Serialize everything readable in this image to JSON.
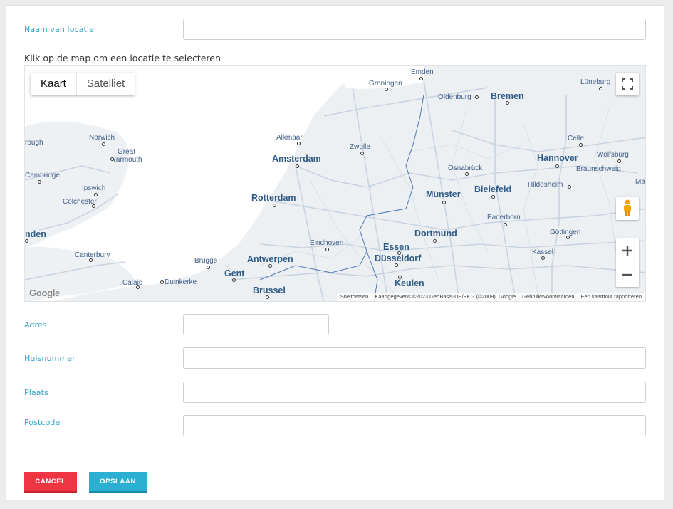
{
  "form": {
    "name_label": "Naam van locatie",
    "name_value": "",
    "map_hint": "Klik op de map om een locatie te selecteren",
    "address_label": "Adres",
    "address_value": "",
    "housenumber_label": "Huisnummer",
    "housenumber_value": "",
    "city_label": "Plaats",
    "city_value": "",
    "postcode_label": "Postcode",
    "postcode_value": ""
  },
  "map": {
    "type_options": [
      "Kaart",
      "Satelliet"
    ],
    "selected_type": "Kaart",
    "fullscreen_icon": "fullscreen-icon",
    "streetview_icon": "pegman-icon",
    "zoom_in": "+",
    "zoom_out": "−",
    "google_logo": "Google",
    "attribution": {
      "shortcuts": "Sneltoetsen",
      "mapdata": "Kaartgegevens ©2023 GeoBasis-DE/BKG (©2009), Google",
      "terms": "Gebruiksvoorwaarden",
      "report": "Een kaartfout rapporteren"
    },
    "cities": [
      {
        "name": "Emden",
        "size": "sm"
      },
      {
        "name": "Groningen",
        "size": "sm"
      },
      {
        "name": "Oldenburg",
        "size": "sm"
      },
      {
        "name": "Bremen",
        "size": "big"
      },
      {
        "name": "Lüneburg",
        "size": "sm"
      },
      {
        "name": "Norwich",
        "size": "sm"
      },
      {
        "name": "Great",
        "size": "sm"
      },
      {
        "name": "Yarmouth",
        "size": "sm"
      },
      {
        "name": "rough",
        "size": "sm"
      },
      {
        "name": "Alkmaar",
        "size": "sm"
      },
      {
        "name": "Amsterdam",
        "size": "big"
      },
      {
        "name": "Zwolle",
        "size": "sm"
      },
      {
        "name": "Celle",
        "size": "sm"
      },
      {
        "name": "Hannover",
        "size": "big"
      },
      {
        "name": "Wolfsburg",
        "size": "sm"
      },
      {
        "name": "Braunschweig",
        "size": "sm"
      },
      {
        "name": "Osnabrück",
        "size": "sm"
      },
      {
        "name": "Cambridge",
        "size": "sm"
      },
      {
        "name": "Ipswich",
        "size": "sm"
      },
      {
        "name": "Colchester",
        "size": "sm"
      },
      {
        "name": "Rotterdam",
        "size": "big"
      },
      {
        "name": "Münster",
        "size": "big"
      },
      {
        "name": "Bielefeld",
        "size": "big"
      },
      {
        "name": "Hildesheim",
        "size": "sm"
      },
      {
        "name": "Ma",
        "size": "sm"
      },
      {
        "name": "Paderborn",
        "size": "sm"
      },
      {
        "name": "nden",
        "size": "big"
      },
      {
        "name": "Dortmund",
        "size": "big"
      },
      {
        "name": "Göttingen",
        "size": "sm"
      },
      {
        "name": "Eindhoven",
        "size": "sm"
      },
      {
        "name": "Essen",
        "size": "big"
      },
      {
        "name": "Canterbury",
        "size": "sm"
      },
      {
        "name": "Düsseldorf",
        "size": "big"
      },
      {
        "name": "Kassel",
        "size": "sm"
      },
      {
        "name": "Brugge",
        "size": "sm"
      },
      {
        "name": "Antwerpen",
        "size": "big"
      },
      {
        "name": "Gent",
        "size": "big"
      },
      {
        "name": "Calais",
        "size": "sm"
      },
      {
        "name": "Duinkerke",
        "size": "sm"
      },
      {
        "name": "Keulen",
        "size": "big"
      },
      {
        "name": "Brussel",
        "size": "big"
      }
    ]
  },
  "actions": {
    "cancel": "CANCEL",
    "save": "OPSLAAN"
  },
  "colors": {
    "label": "#3aa4c8",
    "cancel": "#ee3642",
    "save": "#2bb0d3"
  }
}
